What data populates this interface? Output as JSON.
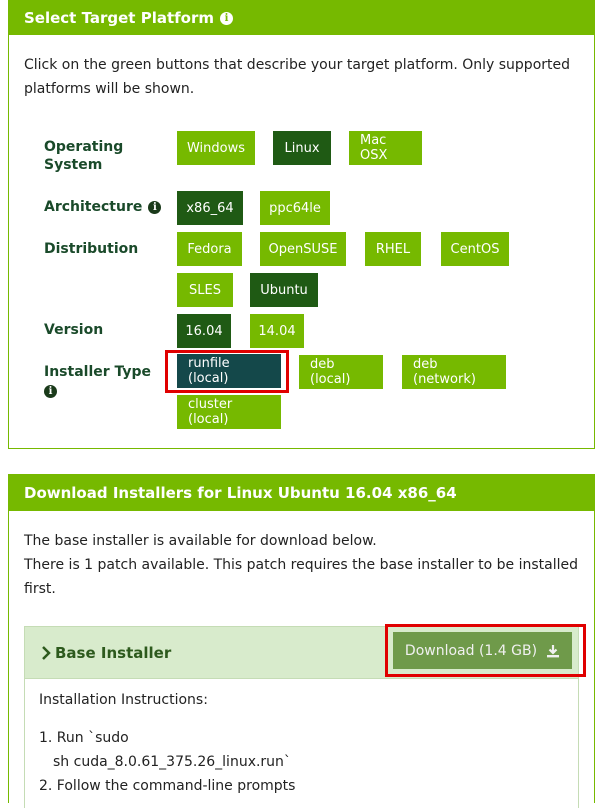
{
  "select_panel": {
    "title": "Select Target Platform",
    "description": "Click on the green buttons that describe your target platform. Only supported platforms will be shown."
  },
  "rows": {
    "os": {
      "label": "Operating System",
      "options": [
        "Windows",
        "Linux",
        "Mac OSX"
      ],
      "selected": "Linux"
    },
    "arch": {
      "label": "Architecture",
      "options": [
        "x86_64",
        "ppc64le"
      ],
      "selected": "x86_64"
    },
    "distro": {
      "label": "Distribution",
      "options": [
        "Fedora",
        "OpenSUSE",
        "RHEL",
        "CentOS",
        "SLES",
        "Ubuntu"
      ],
      "selected": "Ubuntu"
    },
    "version": {
      "label": "Version",
      "options": [
        "16.04",
        "14.04"
      ],
      "selected": "16.04"
    },
    "installer": {
      "label": "Installer Type",
      "options": [
        "runfile (local)",
        "deb (local)",
        "deb (network)",
        "cluster (local)"
      ],
      "selected": "runfile (local)"
    }
  },
  "download_panel": {
    "title": "Download Installers for Linux Ubuntu 16.04 x86_64",
    "line1": "The base installer is available for download below.",
    "line2": "There is 1 patch available. This patch requires the base installer to be installed first.",
    "base_installer_label": "Base Installer",
    "download_button": "Download (1.4 GB)",
    "instructions_heading": "Installation Instructions:",
    "step1_prefix": "1. Run `sudo",
    "step1_cmd": "sh cuda_8.0.61_375.26_linux.run`",
    "step2": "2. Follow the command-line prompts"
  },
  "colors": {
    "accent": "#76b900",
    "selected": "#1f5a14",
    "highlight": "#e00000"
  },
  "icons": {
    "info": "info-icon",
    "chevron": "chevron-right-icon",
    "download": "download-icon"
  }
}
